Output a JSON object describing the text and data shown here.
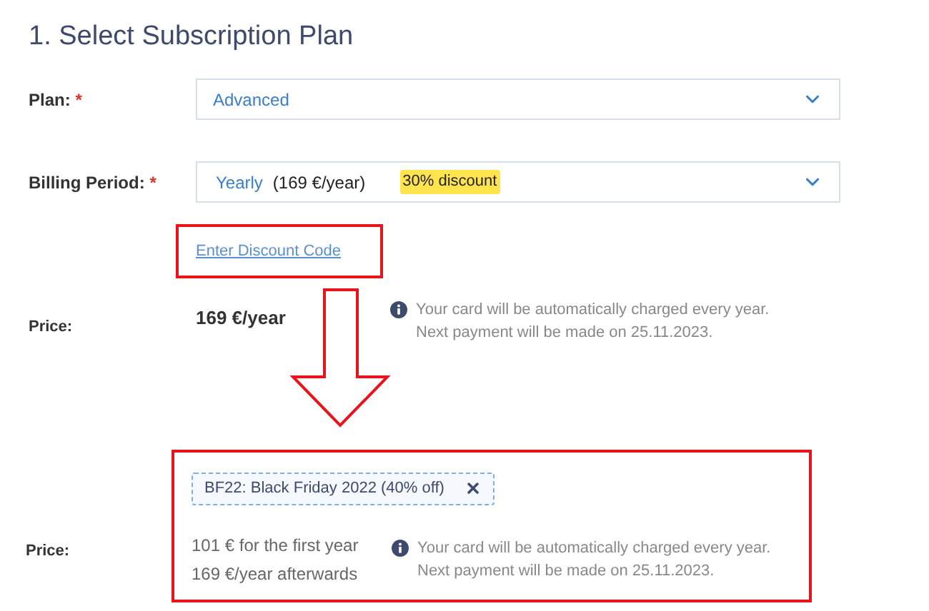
{
  "heading": "1. Select Subscription Plan",
  "plan": {
    "label": "Plan:",
    "required_mark": "*",
    "value": "Advanced"
  },
  "billing": {
    "label": "Billing Period:",
    "required_mark": "*",
    "value": "Yearly",
    "price": "(169 €/year)",
    "badge": "30% discount"
  },
  "discount_link": "Enter Discount Code",
  "price": {
    "label": "Price:",
    "value": "169 €/year",
    "note": [
      "Your card will be automatically charged every year.",
      "Next payment will be made on 25.11.2023."
    ]
  },
  "discounted": {
    "code_chip": "BF22: Black Friday 2022 (40% off)",
    "label": "Price:",
    "lines": [
      "101 € for the first year",
      "169 €/year afterwards"
    ],
    "note": [
      "Your card will be automatically charged every year.",
      "Next payment will be made on 25.11.2023."
    ]
  }
}
